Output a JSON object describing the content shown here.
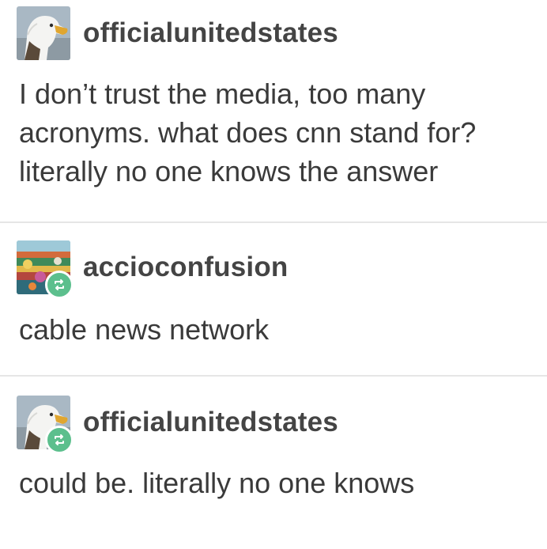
{
  "posts": [
    {
      "username": "officialunitedstates",
      "avatar_icon": "bald-eagle-avatar-icon",
      "reblogged": false,
      "text": "I don’t trust the media, too many\nacronyms. what does cnn stand for?\nliterally no one knows the answer"
    },
    {
      "username": "accioconfusion",
      "avatar_icon": "colorful-landscape-avatar-icon",
      "reblogged": true,
      "reblog_icon": "reblog-icon",
      "text": "cable news network"
    },
    {
      "username": "officialunitedstates",
      "avatar_icon": "bald-eagle-avatar-icon",
      "reblogged": true,
      "reblog_icon": "reblog-icon",
      "text": "could be. literally no one knows"
    }
  ],
  "colors": {
    "reblog_badge": "#5cbf8d",
    "divider": "#e6e6e6",
    "text": "#3a3a3a"
  }
}
